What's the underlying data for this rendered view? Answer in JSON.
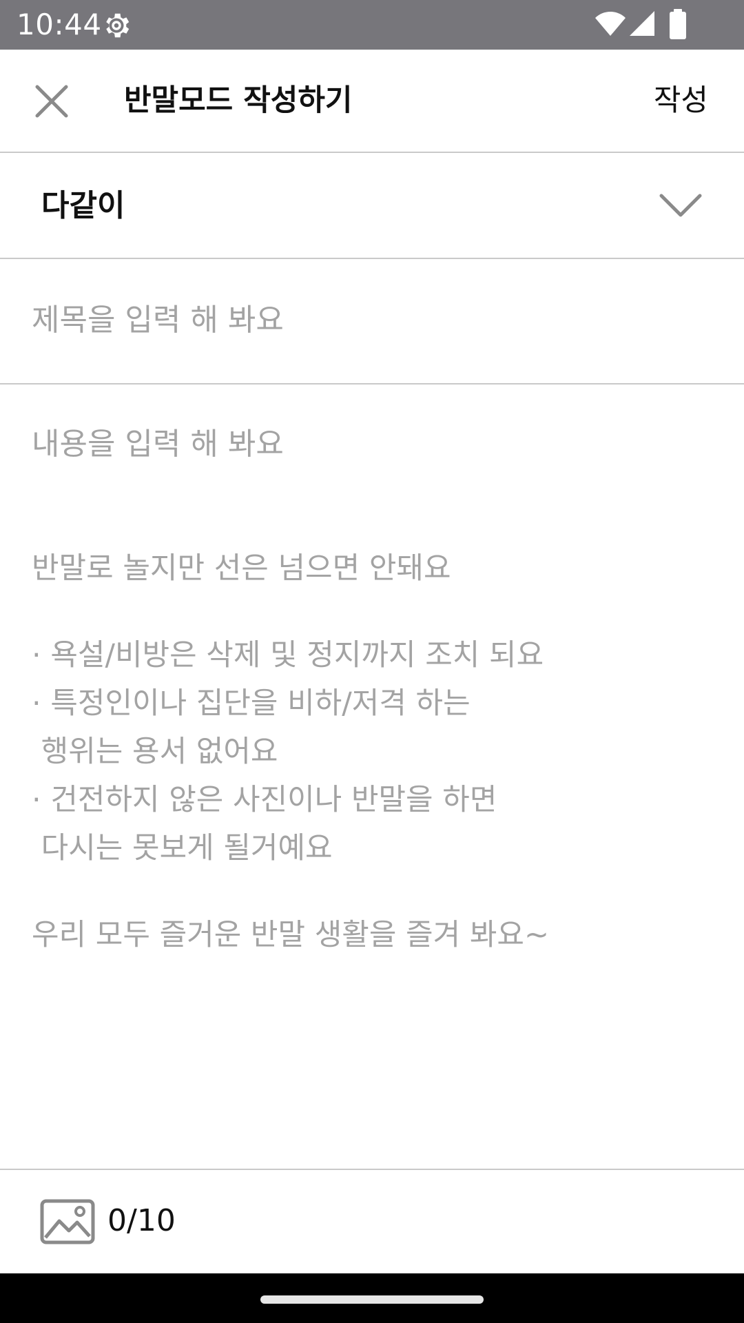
{
  "status_bar": {
    "time": "10:44",
    "icons": [
      "gear-icon",
      "wifi-icon",
      "signal-icon",
      "battery-icon"
    ]
  },
  "header": {
    "close_icon": "close-icon",
    "title": "반말모드 작성하기",
    "submit_label": "작성"
  },
  "category": {
    "selected": "다같이",
    "icon": "chevron-down-icon"
  },
  "form": {
    "title_placeholder": "제목을 입력 해 봐요",
    "content_placeholder": "내용을 입력 해 봐요"
  },
  "guide": {
    "intro": "반말로 놀지만 선은 넘으면 안돼요",
    "rules": [
      "· 욕설/비방은 삭제 및 정지까지 조치 되요",
      "· 특정인이나 집단을 비하/저격 하는",
      " 행위는 용서 없어요",
      "· 건전하지 않은 사진이나 반말을 하면",
      " 다시는 못보게 될거예요"
    ],
    "outro": "우리 모두 즐거운 반말 생활을 즐겨 봐요~"
  },
  "attachments": {
    "icon": "image-icon",
    "count": "0/10"
  },
  "colors": {
    "status_bar": "#77767b",
    "divider": "#c9c9c9",
    "placeholder": "#a3a3a3",
    "text": "#111111"
  }
}
